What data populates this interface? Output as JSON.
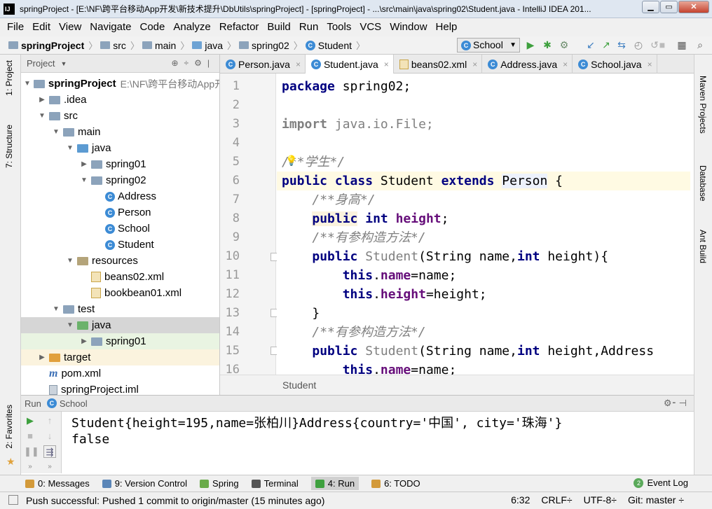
{
  "window": {
    "title": "springProject - [E:\\NF\\跨平台移动App开发\\新技术提升\\DbUtils\\springProject] - [springProject] - ...\\src\\main\\java\\spring02\\Student.java - IntelliJ IDEA 201...",
    "app_icon": "IJ"
  },
  "menu": [
    "File",
    "Edit",
    "View",
    "Navigate",
    "Code",
    "Analyze",
    "Refactor",
    "Build",
    "Run",
    "Tools",
    "VCS",
    "Window",
    "Help"
  ],
  "breadcrumbs": [
    "springProject",
    "src",
    "main",
    "java",
    "spring02",
    "Student"
  ],
  "run_config": "School",
  "left_strip": {
    "project": "1: Project",
    "structure": "7: Structure",
    "favorites": "2: Favorites"
  },
  "right_strip": {
    "maven": "Maven Projects",
    "database": "Database",
    "ant": "Ant Build"
  },
  "project_panel": {
    "title": "Project",
    "tree": [
      {
        "label": "springProject",
        "hint": "E:\\NF\\跨平台移动App开",
        "depth": 0,
        "toggle": "open",
        "icon": "folder",
        "bold": true
      },
      {
        "label": ".idea",
        "depth": 1,
        "toggle": "closed",
        "icon": "folder"
      },
      {
        "label": "src",
        "depth": 1,
        "toggle": "open",
        "icon": "folder"
      },
      {
        "label": "main",
        "depth": 2,
        "toggle": "open",
        "icon": "folder"
      },
      {
        "label": "java",
        "depth": 3,
        "toggle": "open",
        "icon": "src"
      },
      {
        "label": "spring01",
        "depth": 4,
        "toggle": "closed",
        "icon": "folder"
      },
      {
        "label": "spring02",
        "depth": 4,
        "toggle": "open",
        "icon": "folder"
      },
      {
        "label": "Address",
        "depth": 5,
        "toggle": "none",
        "icon": "class"
      },
      {
        "label": "Person",
        "depth": 5,
        "toggle": "none",
        "icon": "class"
      },
      {
        "label": "School",
        "depth": 5,
        "toggle": "none",
        "icon": "class"
      },
      {
        "label": "Student",
        "depth": 5,
        "toggle": "none",
        "icon": "class"
      },
      {
        "label": "resources",
        "depth": 3,
        "toggle": "open",
        "icon": "res"
      },
      {
        "label": "beans02.xml",
        "depth": 4,
        "toggle": "none",
        "icon": "xml"
      },
      {
        "label": "bookbean01.xml",
        "depth": 4,
        "toggle": "none",
        "icon": "xml"
      },
      {
        "label": "test",
        "depth": 2,
        "toggle": "open",
        "icon": "folder"
      },
      {
        "label": "java",
        "depth": 3,
        "toggle": "open",
        "icon": "test",
        "state": "sel-gray"
      },
      {
        "label": "spring01",
        "depth": 4,
        "toggle": "closed",
        "icon": "folder",
        "state": "sel-green"
      },
      {
        "label": "target",
        "depth": 1,
        "toggle": "closed",
        "icon": "tgt",
        "state": "sel-yellow"
      },
      {
        "label": "pom.xml",
        "depth": 1,
        "toggle": "none",
        "icon": "maven"
      },
      {
        "label": "springProject.iml",
        "depth": 1,
        "toggle": "none",
        "icon": "iml"
      }
    ]
  },
  "editor": {
    "tabs": [
      {
        "label": "Person.java",
        "icon": "class",
        "active": false
      },
      {
        "label": "Student.java",
        "icon": "class",
        "active": true
      },
      {
        "label": "beans02.xml",
        "icon": "xml",
        "active": false
      },
      {
        "label": "Address.java",
        "icon": "class",
        "active": false
      },
      {
        "label": "School.java",
        "icon": "class",
        "active": false
      }
    ],
    "line_numbers": [
      "1",
      "2",
      "3",
      "4",
      "5",
      "6",
      "7",
      "8",
      "9",
      "10",
      "11",
      "12",
      "13",
      "14",
      "15",
      "16"
    ],
    "footer": "Student"
  },
  "run_panel": {
    "label": "Run",
    "config": "School",
    "output": [
      "Student{height=195,name=张柏川}Address{country='中国', city='珠海'}",
      "false"
    ]
  },
  "bottom_tabs": [
    {
      "label": "0: Messages",
      "color": "#d39a3a"
    },
    {
      "label": "9: Version Control",
      "color": "#5b86b8"
    },
    {
      "label": "Spring",
      "color": "#6aab4a"
    },
    {
      "label": "Terminal",
      "color": "#555555"
    },
    {
      "label": "4: Run",
      "color": "#3ea03e",
      "active": true
    },
    {
      "label": "6: TODO",
      "color": "#d39a3a"
    }
  ],
  "event_log": "Event Log",
  "status": {
    "message": "Push successful: Pushed 1 commit to origin/master (15 minutes ago)",
    "position": "6:32",
    "line_sep": "CRLF÷",
    "encoding": "UTF-8÷",
    "vcs": "Git: master ÷"
  }
}
